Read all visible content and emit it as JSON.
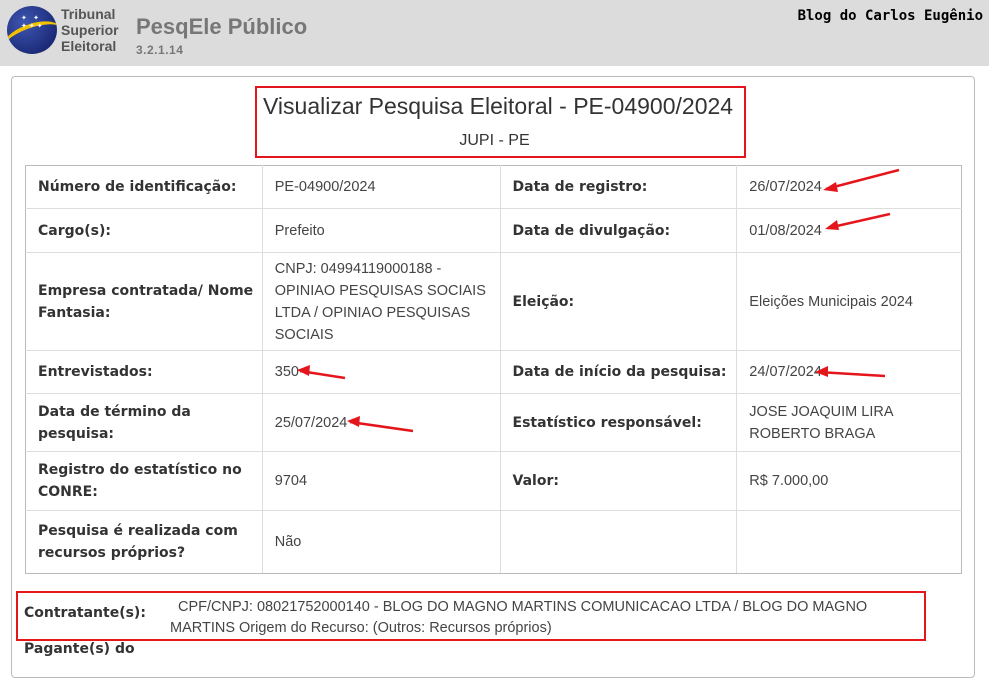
{
  "header": {
    "logo_lines": [
      "Tribunal",
      "Superior",
      "Eleitoral"
    ],
    "app_title": "PesqEle Público",
    "app_version": "3.2.1.14",
    "blog_credit": "Blog do Carlos Eugênio"
  },
  "page": {
    "title": "Visualizar Pesquisa Eleitoral - PE-04900/2024",
    "subtitle": "JUPI - PE"
  },
  "details": {
    "rows": [
      {
        "label1": "Número de identificação:",
        "value1": "PE-04900/2024",
        "label2": "Data de registro:",
        "value2": "26/07/2024"
      },
      {
        "label1": "Cargo(s):",
        "value1": "Prefeito",
        "label2": "Data de divulgação:",
        "value2": "01/08/2024"
      },
      {
        "label1": "Empresa contratada/ Nome Fantasia:",
        "value1": "CNPJ: 04994119000188 - OPINIAO PESQUISAS SOCIAIS LTDA / OPINIAO PESQUISAS SOCIAIS",
        "label2": "Eleição:",
        "value2": "Eleições Municipais 2024"
      },
      {
        "label1": "Entrevistados:",
        "value1": "350",
        "label2": "Data de início da pesquisa:",
        "value2": "24/07/2024"
      },
      {
        "label1": "Data de término da pesquisa:",
        "value1": "25/07/2024",
        "label2": "Estatístico responsável:",
        "value2": "JOSE JOAQUIM LIRA ROBERTO BRAGA"
      },
      {
        "label1": "Registro do estatístico no CONRE:",
        "value1": "9704",
        "label2": "Valor:",
        "value2": "R$ 7.000,00"
      },
      {
        "label1": "Pesquisa é realizada com recursos próprios?",
        "value1": "Não",
        "label2": "",
        "value2": ""
      }
    ]
  },
  "contratante": {
    "label": "Contratante(s):",
    "value": "CPF/CNPJ: 08021752000140 - BLOG DO MAGNO MARTINS COMUNICACAO LTDA / BLOG DO MAGNO MARTINS Origem do Recurso: (Outros: Recursos próprios)"
  },
  "pagantes": {
    "label": "Pagante(s) do"
  },
  "annotation_color": "#e4161b"
}
